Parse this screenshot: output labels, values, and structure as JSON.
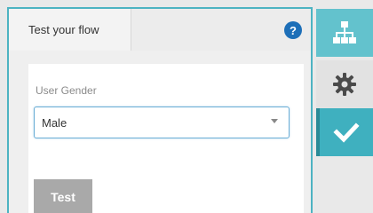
{
  "tab": {
    "label": "Test your flow"
  },
  "help": {
    "symbol": "?"
  },
  "form": {
    "gender_label": "User Gender",
    "gender_value": "Male",
    "test_button": "Test"
  },
  "sidebar": {
    "items": [
      {
        "icon": "sitemap-icon",
        "color": "#63c2cd"
      },
      {
        "icon": "gear-icon",
        "color": "#e2e2e2"
      },
      {
        "icon": "checkmark-icon",
        "color": "#3fb0bf"
      }
    ]
  },
  "colors": {
    "frame": "#4db3c2",
    "help": "#1d6fb8",
    "button_disabled": "#a9a9a9"
  }
}
